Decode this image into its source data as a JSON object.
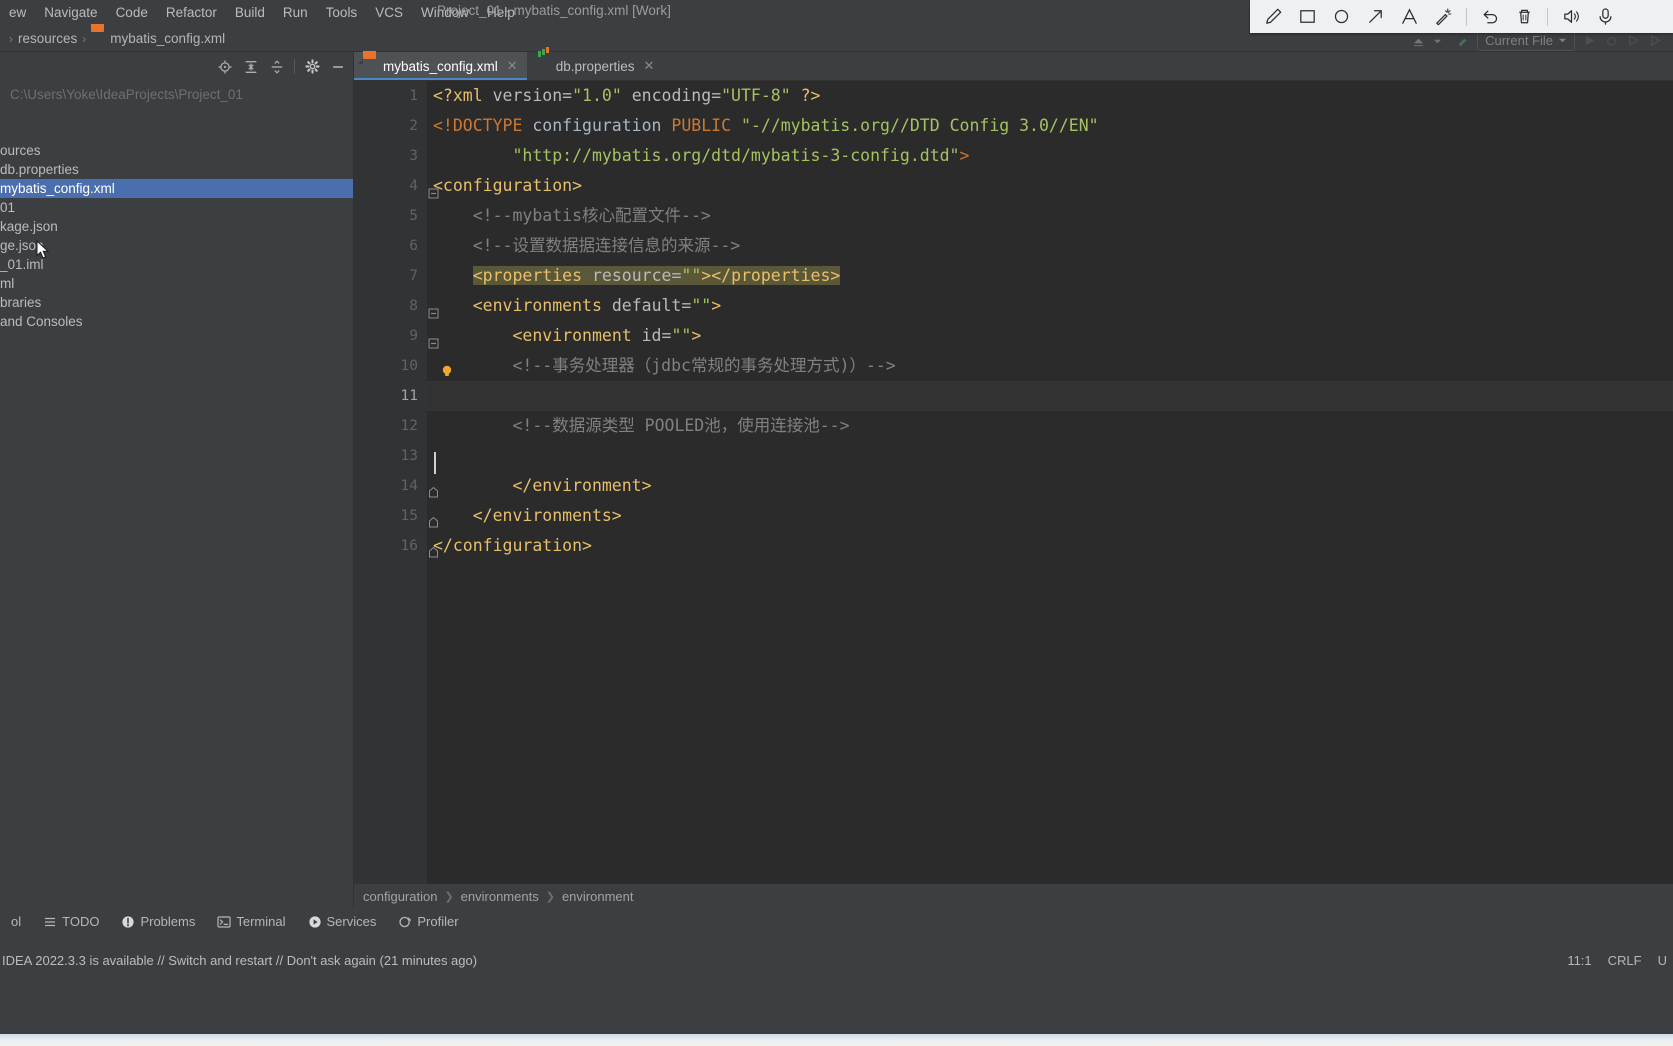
{
  "window": {
    "title": "Project_01 - mybatis_config.xml [Work]"
  },
  "menubar": {
    "items": [
      {
        "label": "ew",
        "name": "menu-view"
      },
      {
        "label": "Navigate",
        "name": "menu-navigate"
      },
      {
        "label": "Code",
        "name": "menu-code"
      },
      {
        "label": "Refactor",
        "name": "menu-refactor"
      },
      {
        "label": "Build",
        "name": "menu-build"
      },
      {
        "label": "Run",
        "name": "menu-run"
      },
      {
        "label": "Tools",
        "name": "menu-tools"
      },
      {
        "label": "VCS",
        "name": "menu-vcs"
      },
      {
        "label": "Window",
        "name": "menu-window"
      },
      {
        "label": "Help",
        "name": "menu-help"
      }
    ]
  },
  "navbar": {
    "crumbs": [
      "resources",
      "mybatis_config.xml"
    ]
  },
  "sidebar": {
    "toolbar": [
      {
        "name": "locate-icon",
        "label": "locate"
      },
      {
        "name": "expand-all-icon",
        "label": "expand-all"
      },
      {
        "name": "collapse-all-icon",
        "label": "collapse-all"
      },
      {
        "name": "gear-icon",
        "label": "settings"
      },
      {
        "name": "minimize-icon",
        "label": "minimize"
      }
    ],
    "project_path": "C:\\Users\\Yoke\\IdeaProjects\\Project_01",
    "tree": [
      {
        "label": "ources",
        "selected": false
      },
      {
        "label": "db.properties",
        "selected": false
      },
      {
        "label": "mybatis_config.xml",
        "selected": true
      },
      {
        "label": "01",
        "selected": false
      },
      {
        "label": "kage.json",
        "selected": false
      },
      {
        "label": "ge.json",
        "selected": false
      },
      {
        "label": "_01.iml",
        "selected": false
      },
      {
        "label": "ml",
        "selected": false
      },
      {
        "label": "braries",
        "selected": false
      },
      {
        "label": "and Consoles",
        "selected": false
      }
    ]
  },
  "editor": {
    "tabs": [
      {
        "label": "mybatis_config.xml",
        "icon": "xml-file-icon",
        "active": true,
        "closable": true
      },
      {
        "label": "db.properties",
        "icon": "properties-file-icon",
        "active": false,
        "closable": true
      }
    ],
    "breadcrumb": [
      "configuration",
      "environments",
      "environment"
    ],
    "lines": [
      {
        "n": "1",
        "current": false,
        "fold": "",
        "bulb": false,
        "highlight": false,
        "tokens": [
          {
            "t": "<?xml ",
            "c": "tk-pi"
          },
          {
            "t": "version",
            "c": "tk-attr"
          },
          {
            "t": "=",
            "c": "tk-plain"
          },
          {
            "t": "\"1.0\"",
            "c": "tk-str"
          },
          {
            "t": " ",
            "c": "tk-plain"
          },
          {
            "t": "encoding",
            "c": "tk-attr"
          },
          {
            "t": "=",
            "c": "tk-plain"
          },
          {
            "t": "\"UTF-8\"",
            "c": "tk-str"
          },
          {
            "t": " ",
            "c": "tk-plain"
          },
          {
            "t": "?>",
            "c": "tk-pi"
          }
        ]
      },
      {
        "n": "2",
        "current": false,
        "fold": "",
        "bulb": false,
        "highlight": false,
        "tokens": [
          {
            "t": "<!DOCTYPE",
            "c": "tk-kw"
          },
          {
            "t": " configuration ",
            "c": "tk-plain"
          },
          {
            "t": "PUBLIC",
            "c": "tk-kw"
          },
          {
            "t": " ",
            "c": "tk-plain"
          },
          {
            "t": "\"-//mybatis.org//DTD Config 3.0//EN\"",
            "c": "tk-str"
          }
        ]
      },
      {
        "n": "3",
        "current": false,
        "fold": "",
        "bulb": false,
        "highlight": false,
        "tokens": [
          {
            "t": "        \"http://mybatis.org/dtd/mybatis-3-config.dtd\"",
            "c": "tk-str"
          },
          {
            "t": ">",
            "c": "tk-kw"
          }
        ]
      },
      {
        "n": "4",
        "current": false,
        "fold": "open",
        "bulb": false,
        "highlight": false,
        "tokens": [
          {
            "t": "<configuration>",
            "c": "tk-tag"
          }
        ]
      },
      {
        "n": "5",
        "current": false,
        "fold": "",
        "bulb": false,
        "highlight": false,
        "tokens": [
          {
            "t": "    <!--mybatis核心配置文件-->",
            "c": "tk-cmt"
          }
        ]
      },
      {
        "n": "6",
        "current": false,
        "fold": "",
        "bulb": false,
        "highlight": false,
        "tokens": [
          {
            "t": "    <!--设置数据据连接信息的来源-->",
            "c": "tk-cmt"
          }
        ]
      },
      {
        "n": "7",
        "current": false,
        "fold": "",
        "bulb": false,
        "highlight": true,
        "tokens": [
          {
            "t": "    ",
            "c": "tk-plain"
          },
          {
            "t": "<properties ",
            "c": "tk-tag"
          },
          {
            "t": "resource",
            "c": "tk-attr"
          },
          {
            "t": "=",
            "c": "tk-plain"
          },
          {
            "t": "\"\"",
            "c": "tk-str"
          },
          {
            "t": "></properties>",
            "c": "tk-tag"
          }
        ]
      },
      {
        "n": "8",
        "current": false,
        "fold": "open",
        "bulb": false,
        "highlight": false,
        "tokens": [
          {
            "t": "    ",
            "c": "tk-plain"
          },
          {
            "t": "<environments ",
            "c": "tk-tag"
          },
          {
            "t": "default",
            "c": "tk-attr"
          },
          {
            "t": "=",
            "c": "tk-plain"
          },
          {
            "t": "\"\"",
            "c": "tk-str"
          },
          {
            "t": ">",
            "c": "tk-tag"
          }
        ]
      },
      {
        "n": "9",
        "current": false,
        "fold": "open",
        "bulb": false,
        "highlight": false,
        "tokens": [
          {
            "t": "        ",
            "c": "tk-plain"
          },
          {
            "t": "<environment ",
            "c": "tk-tag"
          },
          {
            "t": "id",
            "c": "tk-attr"
          },
          {
            "t": "=",
            "c": "tk-plain"
          },
          {
            "t": "\"\"",
            "c": "tk-str"
          },
          {
            "t": ">",
            "c": "tk-tag"
          }
        ]
      },
      {
        "n": "10",
        "current": false,
        "fold": "",
        "bulb": true,
        "highlight": false,
        "tokens": [
          {
            "t": "        <!--事务处理器（jdbc常规的事务处理方式)）-->",
            "c": "tk-cmt"
          }
        ]
      },
      {
        "n": "11",
        "current": true,
        "fold": "",
        "bulb": false,
        "highlight": false,
        "tokens": []
      },
      {
        "n": "12",
        "current": false,
        "fold": "",
        "bulb": false,
        "highlight": false,
        "tokens": [
          {
            "t": "        <!--数据源类型 POOLED池，使用连接池-->",
            "c": "tk-cmt"
          }
        ]
      },
      {
        "n": "13",
        "current": false,
        "fold": "",
        "bulb": false,
        "highlight": false,
        "tokens": []
      },
      {
        "n": "14",
        "current": false,
        "fold": "close",
        "bulb": false,
        "highlight": false,
        "tokens": [
          {
            "t": "        </environment>",
            "c": "tk-tag"
          }
        ]
      },
      {
        "n": "15",
        "current": false,
        "fold": "close",
        "bulb": false,
        "highlight": false,
        "tokens": [
          {
            "t": "    </environments>",
            "c": "tk-tag"
          }
        ]
      },
      {
        "n": "16",
        "current": false,
        "fold": "close",
        "bulb": false,
        "highlight": false,
        "tokens": [
          {
            "t": "</configuration>",
            "c": "tk-tag"
          }
        ]
      }
    ]
  },
  "run_toolbar": {
    "config_label": "Current File"
  },
  "annotation_toolbar": {
    "tools": [
      {
        "name": "pen-icon",
        "label": "pen"
      },
      {
        "name": "rectangle-icon",
        "label": "rectangle"
      },
      {
        "name": "ellipse-icon",
        "label": "ellipse"
      },
      {
        "name": "arrow-icon",
        "label": "arrow"
      },
      {
        "name": "text-icon",
        "label": "text"
      },
      {
        "name": "magic-wand-icon",
        "label": "highlighter"
      },
      {
        "name": "undo-icon",
        "label": "undo"
      },
      {
        "name": "trash-icon",
        "label": "delete"
      },
      {
        "name": "speaker-icon",
        "label": "speaker"
      },
      {
        "name": "microphone-icon",
        "label": "microphone"
      }
    ],
    "background": "#eef0f2"
  },
  "toolwindow_bar": {
    "items": [
      {
        "label": "ol",
        "icon": "console-icon"
      },
      {
        "label": "TODO",
        "icon": "todo-icon"
      },
      {
        "label": "Problems",
        "icon": "problems-icon"
      },
      {
        "label": "Terminal",
        "icon": "terminal-icon"
      },
      {
        "label": "Services",
        "icon": "services-icon"
      },
      {
        "label": "Profiler",
        "icon": "profiler-icon"
      }
    ]
  },
  "status": {
    "notification": "IDEA 2022.3.3 is available // Switch and restart // Don't ask again (21 minutes ago)",
    "caret_position": "11:1",
    "line_separator": "CRLF",
    "encoding": "U"
  },
  "colors": {
    "editor_bg": "#2b2b2b",
    "panel_bg": "#3c3f41",
    "gutter_bg": "#313335",
    "selection_blue": "#4b6eaf",
    "tag_gold": "#e8bf6a",
    "string_green": "#a5c261",
    "comment_gray": "#808080",
    "keyword_orange": "#cc7832",
    "highlight_olive": "#5b5839"
  }
}
